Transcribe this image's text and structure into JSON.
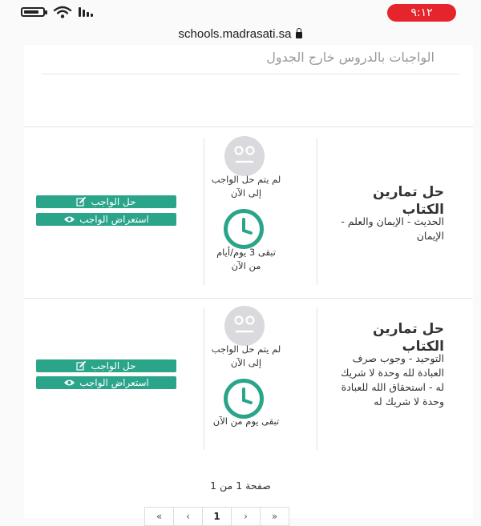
{
  "status_bar": {
    "time": "٩:١٢"
  },
  "browser": {
    "url": "schools.madrasati.sa"
  },
  "section": {
    "title": "الواجبات بالدروس خارج الجدول"
  },
  "assignments": [
    {
      "title": "حل تمارين الكتاب",
      "description": "الحديث - الإيمان والعلم - الإيمان",
      "status": "لم يتم حل الواجب إلى الآن",
      "remaining": "تبقى 3 يوم/أيام من الآن",
      "solve_label": "حل الواجب",
      "view_label": "استعراض الواجب"
    },
    {
      "title": "حل تمارين الكتاب",
      "description": "التوحيد - وجوب صرف العبادة لله وحدة لا شريك له - استحقاق الله للعبادة وحدة لا شريك له",
      "status": "لم يتم حل الواجب إلى الآن",
      "remaining": "تبقى يوم من الآن",
      "solve_label": "حل الواجب",
      "view_label": "استعراض الواجب"
    }
  ],
  "pagination": {
    "summary": "صفحة 1 من 1",
    "buttons": [
      "«",
      "‹",
      "1",
      "›",
      "»"
    ],
    "current": "1"
  },
  "colors": {
    "accent": "#2aa58a",
    "status_pill": "#e5242b",
    "face": "#d9d9de",
    "face_features": "#ffffff"
  },
  "icons": {
    "battery": "battery-icon",
    "wifi": "wifi-icon",
    "signal": "signal-icon",
    "lock": "lock-icon",
    "face": "neutral-face-icon",
    "clock": "clock-icon",
    "edit": "edit-icon",
    "eye": "eye-icon"
  }
}
